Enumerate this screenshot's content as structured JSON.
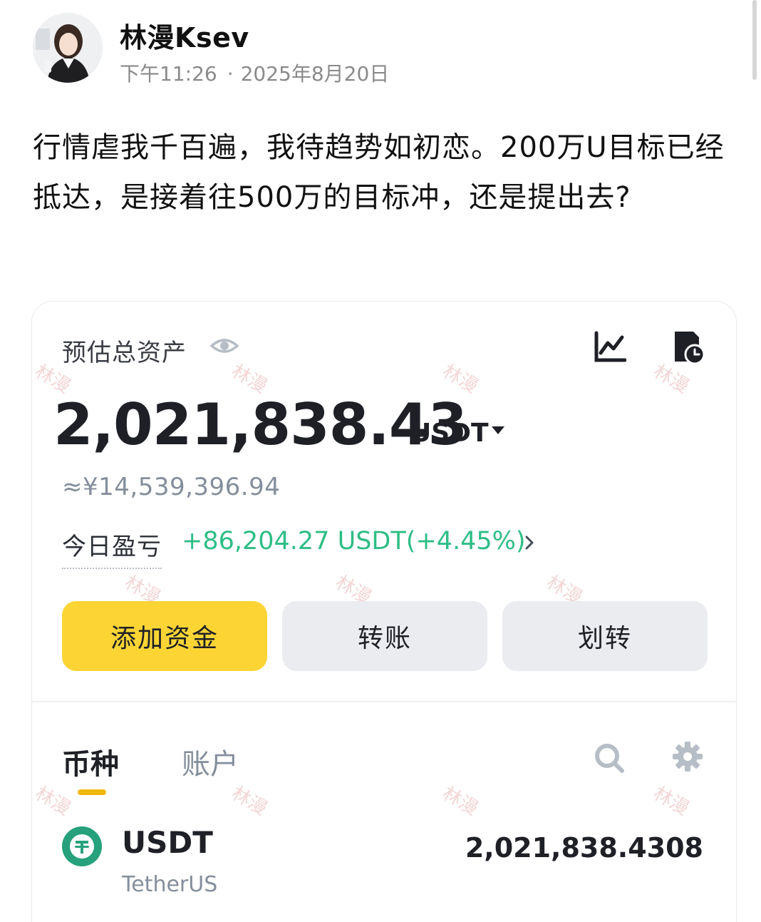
{
  "post": {
    "author": "林漫Ksev",
    "time": "下午11:26",
    "date": "2025年8月20日",
    "text": "行情虐我千百遍，我待趋势如初恋。200万U目标已经抵达，是接着往500万的目标冲，还是提出去?"
  },
  "wallet": {
    "estimated_label": "预估总资产",
    "total": "2,021,838.43",
    "unit": "USDT",
    "fiat": "≈¥14,539,396.94",
    "pnl_label": "今日盈亏",
    "pnl_value": "+86,204.27 USDT(+4.45%)",
    "buttons": {
      "add_funds": "添加资金",
      "transfer": "转账",
      "move": "划转"
    },
    "tabs": {
      "coins": "币种",
      "accounts": "账户"
    },
    "assets": [
      {
        "symbol": "USDT",
        "name": "TetherUS",
        "amount": "2,021,838.4308"
      }
    ],
    "watermark": "林漫"
  },
  "colors": {
    "accent": "#fcd535",
    "positive": "#2ebd85",
    "tab_indicator": "#f0b90b",
    "tether": "#26a17b"
  }
}
